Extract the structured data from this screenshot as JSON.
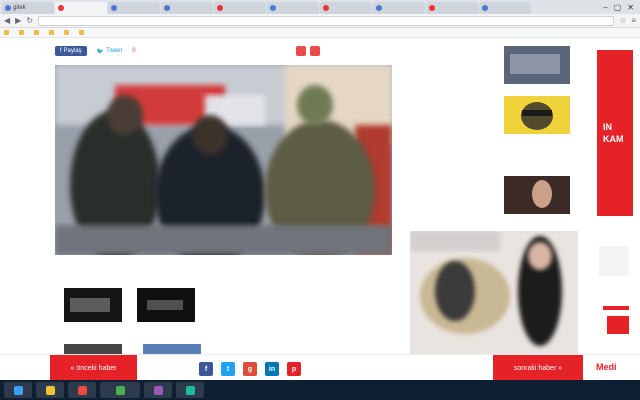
{
  "browser": {
    "tabs": [
      {
        "label": "gitek",
        "active": false
      },
      {
        "label": "",
        "active": true
      },
      {
        "label": "",
        "active": false
      },
      {
        "label": "",
        "active": false
      },
      {
        "label": "",
        "active": false
      },
      {
        "label": "",
        "active": false
      },
      {
        "label": "",
        "active": false
      },
      {
        "label": "",
        "active": false
      },
      {
        "label": "",
        "active": false
      },
      {
        "label": "",
        "active": false
      },
      {
        "label": "",
        "active": false
      }
    ],
    "window_controls": [
      "–",
      "▢",
      "✕"
    ],
    "url": "",
    "bookmarks": [
      "",
      "",
      "",
      "",
      "",
      "",
      "",
      "",
      ""
    ]
  },
  "article": {
    "share": {
      "facebook_label": "Paylaş",
      "twitter_label": "Tweet",
      "count": "0"
    },
    "tags": [
      "",
      ""
    ],
    "caption": "",
    "caption_source": "",
    "paragraphs": [
      "",
      "",
      "",
      "",
      "",
      ""
    ]
  },
  "sidebar": {
    "items": [
      {
        "text": ""
      },
      {
        "text": ""
      },
      {
        "text": ""
      },
      {
        "text": ""
      }
    ]
  },
  "ad": {
    "line1": "IN",
    "line2": "KAM",
    "bottom_text": "Medi"
  },
  "bottom_bar": {
    "prev_label": "« önceki haber",
    "next_label": "sonraki haber »",
    "links": [
      "",
      "",
      ""
    ]
  },
  "colors": {
    "accent": "#e62229",
    "facebook": "#3b5998",
    "twitter": "#1da1f2"
  }
}
